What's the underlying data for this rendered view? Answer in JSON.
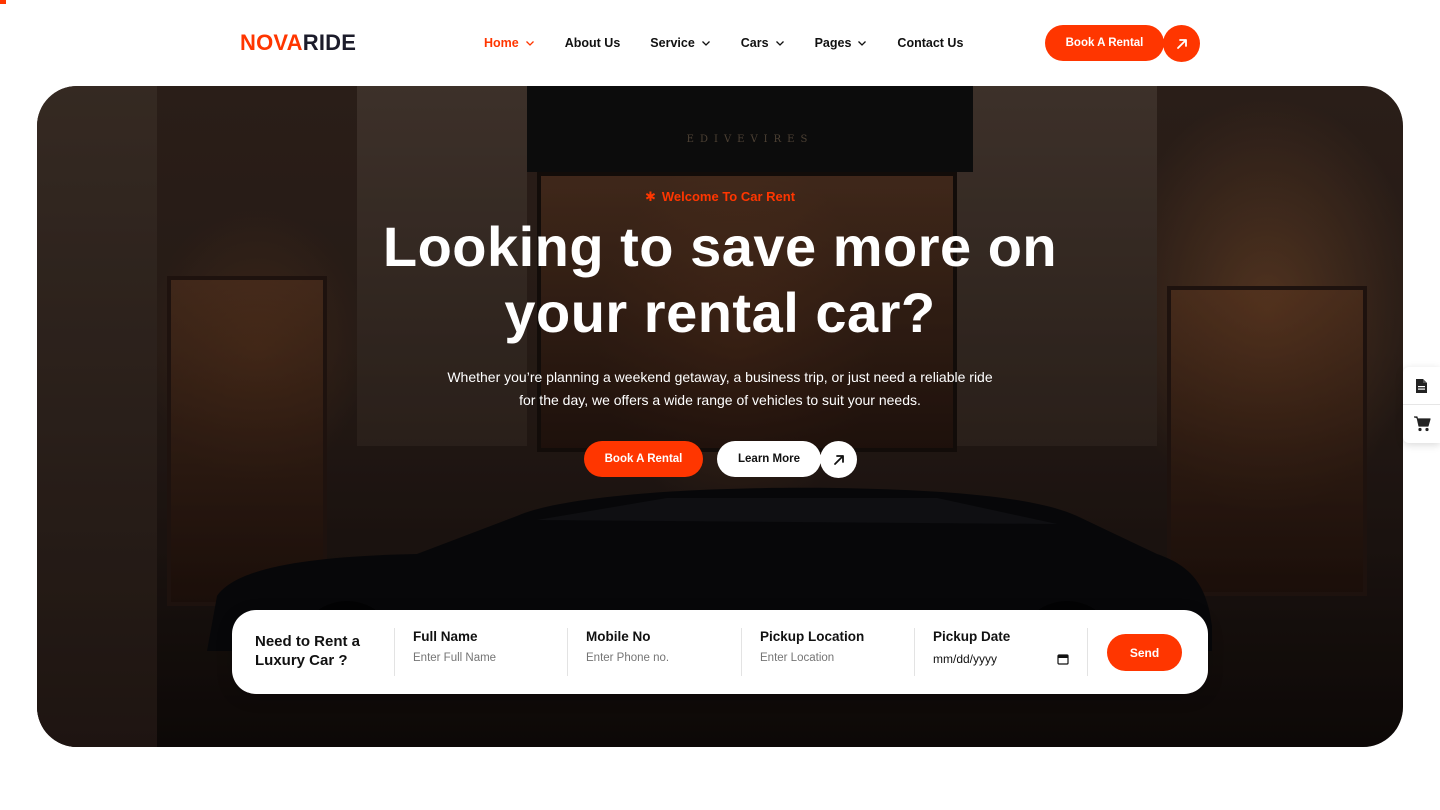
{
  "brand": {
    "name_part1": "NOVA",
    "name_part2": "RIDE",
    "accent": "#ff3600",
    "dark": "#1c1c2b"
  },
  "nav": {
    "items": [
      {
        "label": "Home",
        "has_dropdown": true,
        "active": true
      },
      {
        "label": "About Us",
        "has_dropdown": false
      },
      {
        "label": "Service",
        "has_dropdown": true
      },
      {
        "label": "Cars",
        "has_dropdown": true
      },
      {
        "label": "Pages",
        "has_dropdown": true
      },
      {
        "label": "Contact Us",
        "has_dropdown": false
      }
    ],
    "cta_label": "Book A Rental",
    "cta_icon": "arrow-up-right-icon"
  },
  "hero": {
    "tagline": "Welcome To Car Rent",
    "tagline_icon": "asterisk-icon",
    "headline_line1": "Looking to save more on",
    "headline_line2": "your rental car?",
    "subtext_line1": "Whether you’re planning a weekend getaway, a business trip, or just need a reliable ride",
    "subtext_line2": "for the day, we offers a wide range of vehicles to suit your needs.",
    "primary_button": "Book A Rental",
    "secondary_button": "Learn More",
    "secondary_icon": "arrow-up-right-icon"
  },
  "booking_form": {
    "title": "Need to Rent a Luxury Car ?",
    "fields": [
      {
        "label": "Full Name",
        "placeholder": "Enter Full Name"
      },
      {
        "label": "Mobile No",
        "placeholder": "Enter Phone no."
      },
      {
        "label": "Pickup Location",
        "placeholder": "Enter Location"
      },
      {
        "label": "Pickup Date",
        "value": "mm/dd/yyyy",
        "icon": "calendar-icon"
      }
    ],
    "submit_label": "Send"
  },
  "side_panel": {
    "icons": [
      "document-icon",
      "cart-icon"
    ]
  }
}
